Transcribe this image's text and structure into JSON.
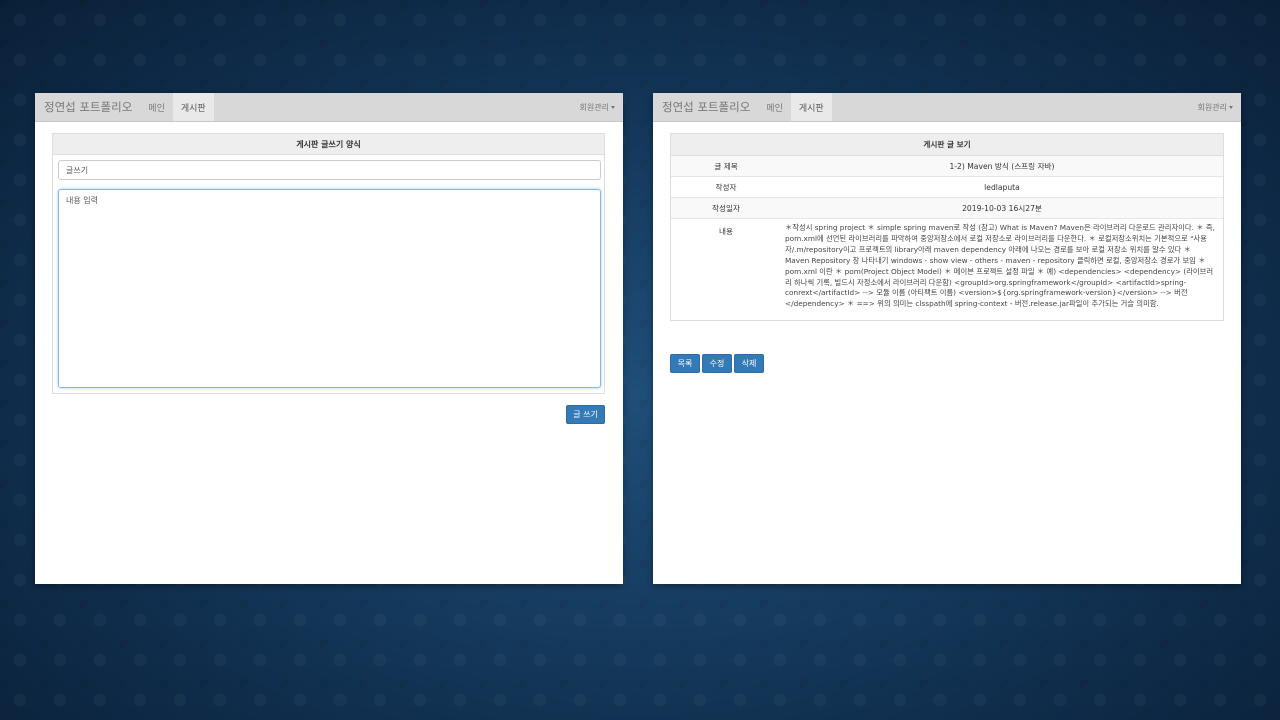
{
  "left": {
    "navbar": {
      "brand": "정연섭 포트폴리오",
      "nav_main": "메인",
      "nav_board": "게시판",
      "member_menu": "회원관리"
    },
    "form": {
      "header": "게시판 글쓰기 양식",
      "title_placeholder": "글쓰기",
      "content_placeholder": "내용 입력",
      "submit_label": "글 쓰기"
    }
  },
  "right": {
    "navbar": {
      "brand": "정연섭 포트폴리오",
      "nav_main": "메인",
      "nav_board": "게시판",
      "member_menu": "회원관리"
    },
    "view": {
      "header": "게시판 글 보기",
      "title_label": "글 제목",
      "title_value": "1-2) Maven 방식 (스프링 자바)",
      "author_label": "작성자",
      "author_value": "ledlaputa",
      "date_label": "작성일자",
      "date_value": "2019-10-03 16시27분",
      "content_label": "내용",
      "content_value": "＊작성시 spring project ＊ simple spring maven로 작성 (참고) What is Maven? Maven은 라이브러리 다운로드 관리자이다. ＊ 즉, pom.xml에 선언된 라이브러리를 파악하여 중앙저장소에서 로컬 저장소로 라이브러리를 다운한다. ＊ 로컬저장소위치는 기본적으로 \"사용자/.m/repository이고 프로젝트의 library아래 maven dependency 아래에 나오는 경로를 보아 로컬 저장소 위치를 알수 있다 ＊ Maven Repository 창 나타내기 windows - show view - others - maven - repository 클릭하면 로컬, 중앙저장소 경로가 보임 ＊ pom.xml 이란 ＊ pom(Project Object Model) ＊ 메이븐 프로젝트 설정 파일 ＊ 예) <dependencies> <dependency> (라이브러리 하나씩 기록, 빌드시 자정소에서 라이브러리 다운함) <groupId>org.springframework</groupId> <artifactId>spring-conrext</artifactId> --> 모듈 이름 (아티팩트 이름) <version>${org.springframework-version}</version> --> 버전 </dependency> ＊ ==> 위의 의미는 clsspath에 spring-context - 버전.release.jar파일이 추가되는 거슬 의미함."
    },
    "buttons": {
      "list": "목록",
      "edit": "수정",
      "delete": "삭제"
    }
  }
}
